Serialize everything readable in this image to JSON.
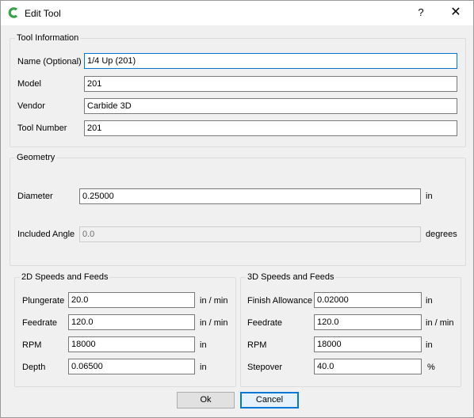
{
  "window": {
    "title": "Edit Tool",
    "icon": "carbide-create-logo-icon",
    "help_label": "?",
    "close_label": "✕"
  },
  "tool_info": {
    "title": "Tool Information",
    "name_label": "Name (Optional)",
    "name_value": "1/4 Up (201)",
    "model_label": "Model",
    "model_value": "201",
    "vendor_label": "Vendor",
    "vendor_value": "Carbide 3D",
    "tool_number_label": "Tool Number",
    "tool_number_value": "201"
  },
  "geometry": {
    "title": "Geometry",
    "diameter_label": "Diameter",
    "diameter_value": "0.25000",
    "diameter_unit": "in",
    "angle_label": "Included Angle",
    "angle_value": "0.0",
    "angle_unit": "degrees"
  },
  "speeds_2d": {
    "title": "2D Speeds and Feeds",
    "plungerate_label": "Plungerate",
    "plungerate_value": "20.0",
    "plungerate_unit": "in / min",
    "feedrate_label": "Feedrate",
    "feedrate_value": "120.0",
    "feedrate_unit": "in / min",
    "rpm_label": "RPM",
    "rpm_value": "18000",
    "rpm_unit": "in",
    "depth_label": "Depth",
    "depth_value": "0.06500",
    "depth_unit": "in"
  },
  "speeds_3d": {
    "title": "3D Speeds and Feeds",
    "finish_label": "Finish Allowance",
    "finish_value": "0.02000",
    "finish_unit": "in",
    "feedrate_label": "Feedrate",
    "feedrate_value": "120.0",
    "feedrate_unit": "in / min",
    "rpm_label": "RPM",
    "rpm_value": "18000",
    "rpm_unit": "in",
    "stepover_label": "Stepover",
    "stepover_value": "40.0",
    "stepover_unit": "%"
  },
  "buttons": {
    "ok_label": "Ok",
    "cancel_label": "Cancel"
  },
  "colors": {
    "focus_accent": "#0078d7",
    "logo_green": "#3aa14a"
  }
}
